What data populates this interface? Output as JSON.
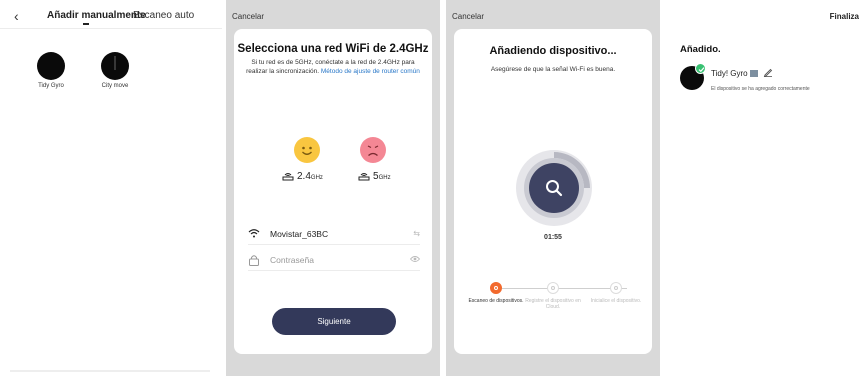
{
  "panel1": {
    "back_icon": "chevron-left-icon",
    "tabs": [
      {
        "label": "Añadir manualmente",
        "active": true
      },
      {
        "label": "Escaneo auto",
        "active": false
      }
    ],
    "devices": [
      {
        "label": "Tidy Gyro"
      },
      {
        "label": "City move"
      }
    ]
  },
  "panel2": {
    "cancel": "Cancelar",
    "title": "Selecciona una red WiFi de 2.4GHz",
    "desc": "Si tu red es de 5GHz, conéctate a la red de 2.4GHz para realizar la sincronización.",
    "desc_link": "Método de ajuste de router común",
    "freq_good": {
      "value": "2.4",
      "unit": "GHz"
    },
    "freq_bad": {
      "value": "5",
      "unit": "GHz"
    },
    "wifi_name": "Movistar_63BC",
    "password_placeholder": "Contraseña",
    "next_button": "Siguiente",
    "colors": {
      "button": "#33395a",
      "link": "#2a78c8",
      "good_face": "#f9c640",
      "bad_face": "#f48794"
    }
  },
  "panel3": {
    "cancel": "Cancelar",
    "title": "Añadiendo dispositivo...",
    "desc": "Asegúrese de que la señal Wi-Fi es buena.",
    "timer": "01:55",
    "steps": [
      {
        "label": "Escaneo de dispositivos.",
        "active": true
      },
      {
        "label": "Registre el dispositivo en Cloud.",
        "active": false
      },
      {
        "label": "Inicialice el dispositivo.",
        "active": false
      }
    ],
    "colors": {
      "active_step": "#f26a2e",
      "spinner": "#3e4363"
    }
  },
  "panel4": {
    "finish": "Finaliza",
    "added_title": "Añadido.",
    "device_name": "Tidy! Gyro",
    "success_text": "El dispositivo se ha agregado correctamente",
    "colors": {
      "check": "#38c172"
    }
  }
}
